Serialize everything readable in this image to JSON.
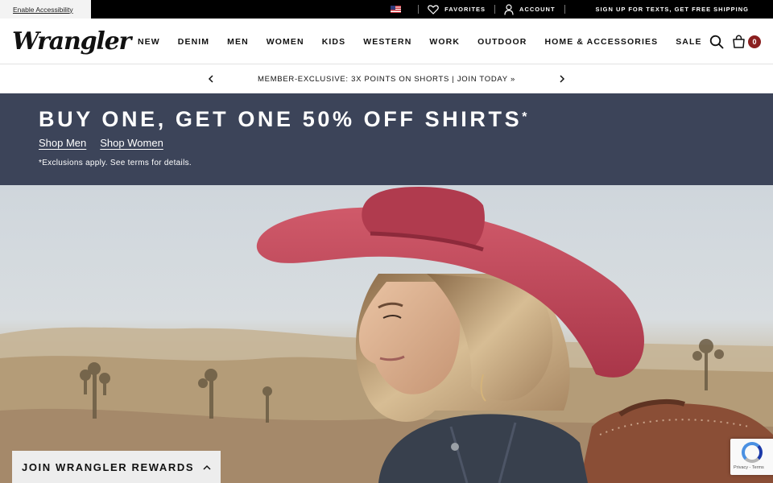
{
  "utility_bar": {
    "accessibility_label": "Enable Accessibility",
    "favorites_label": "FAVORITES",
    "account_label": "ACCOUNT",
    "sms_promo": "SIGN UP FOR TEXTS, GET FREE SHIPPING"
  },
  "header": {
    "logo_text": "Wrangler",
    "nav": [
      "NEW",
      "DENIM",
      "MEN",
      "WOMEN",
      "KIDS",
      "WESTERN",
      "WORK",
      "OUTDOOR",
      "HOME & ACCESSORIES",
      "SALE"
    ],
    "cart_count": "0"
  },
  "promo_strip": {
    "text": "MEMBER-EXCLUSIVE: 3X POINTS ON SHORTS | JOIN TODAY »"
  },
  "banner": {
    "title": "BUY ONE, GET ONE 50% OFF SHIRTS",
    "title_mark": "*",
    "link_men": "Shop Men",
    "link_women": "Shop Women",
    "note": "*Exclusions apply. See terms for details."
  },
  "rewards": {
    "label": "JOIN WRANGLER REWARDS"
  },
  "recaptcha": {
    "text": "Privacy - Terms"
  },
  "colors": {
    "banner_bg": "#3c4459",
    "cart_badge": "#8a1f1f",
    "hat": "#c4485a"
  }
}
